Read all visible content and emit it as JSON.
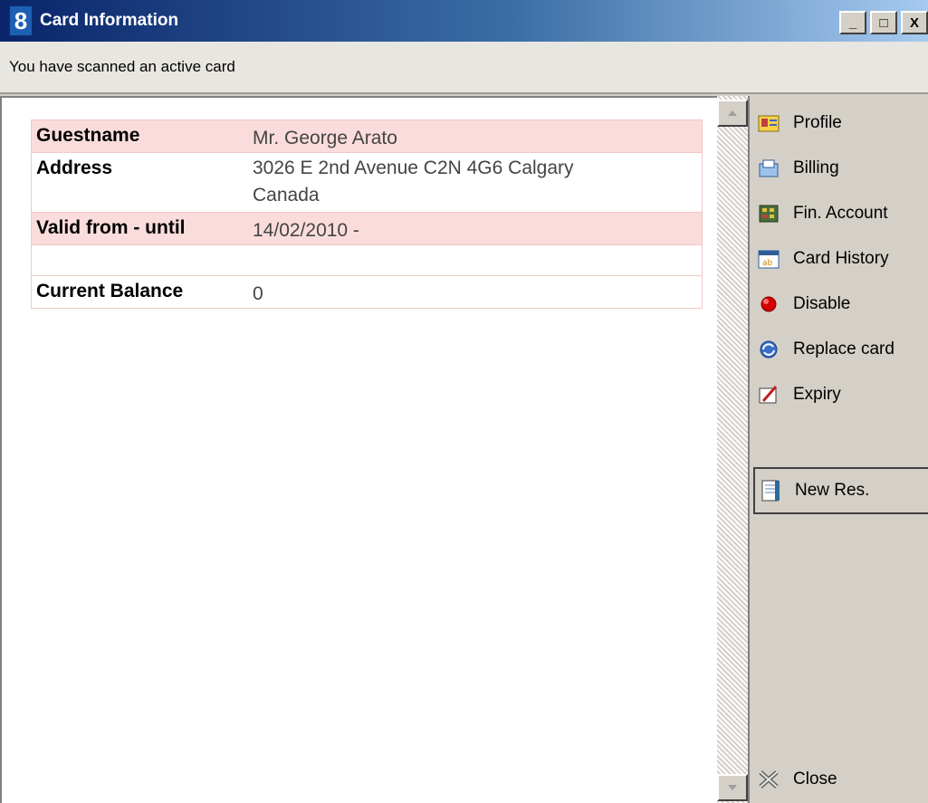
{
  "window": {
    "title": "Card Information",
    "app_icon_glyph": "8",
    "buttons": {
      "minimize": "_",
      "maximize": "□",
      "close": "X"
    }
  },
  "status": {
    "message": "You have scanned an active card"
  },
  "card_info": {
    "rows": [
      {
        "label": "Guestname",
        "value": "Mr. George Arato"
      },
      {
        "label": "Address",
        "value_line1": "3026 E 2nd Avenue C2N 4G6 Calgary",
        "value_line2": "Canada"
      },
      {
        "label": "Valid from - until",
        "value": "14/02/2010 -"
      },
      {
        "label": "",
        "value": ""
      },
      {
        "label": "Current Balance",
        "value": "0"
      }
    ]
  },
  "sidebar": {
    "items": [
      {
        "label": "Profile",
        "icon": "profile-icon"
      },
      {
        "label": "Billing",
        "icon": "billing-icon"
      },
      {
        "label": "Fin. Account",
        "icon": "fin-account-icon"
      },
      {
        "label": "Card History",
        "icon": "card-history-icon"
      },
      {
        "label": "Disable",
        "icon": "disable-icon"
      },
      {
        "label": "Replace card",
        "icon": "replace-card-icon"
      },
      {
        "label": "Expiry",
        "icon": "expiry-icon"
      },
      {
        "label": "New Res.",
        "icon": "new-res-icon"
      },
      {
        "label": "Close",
        "icon": "close-icon"
      }
    ]
  },
  "colors": {
    "titlebar_start": "#0a246a",
    "row_pink": "#fbdcdc",
    "disable_red": "#d40000"
  }
}
